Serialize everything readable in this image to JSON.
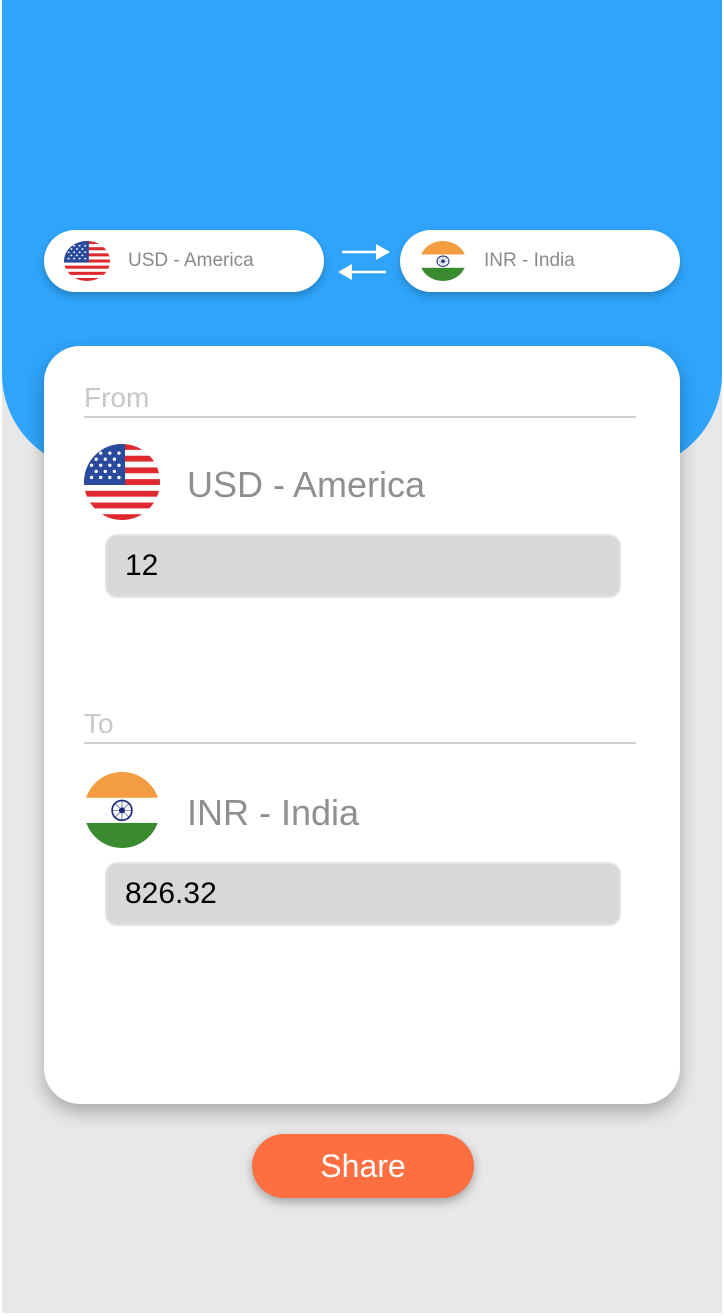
{
  "selector": {
    "from": {
      "label": "USD - America",
      "flag_icon": "us-flag-icon"
    },
    "to": {
      "label": "INR - India",
      "flag_icon": "india-flag-icon"
    },
    "swap_icon": "swap-arrows-icon"
  },
  "converter": {
    "from": {
      "section_label": "From",
      "currency": "USD - America",
      "amount": "12"
    },
    "to": {
      "section_label": "To",
      "currency": "INR - India",
      "amount": "826.32"
    }
  },
  "share_label": "Share",
  "colors": {
    "header": "#2fa4fa",
    "background": "#e8e8e8",
    "share_button": "#fd6f41",
    "india_saffron": "#f39c41",
    "india_green": "#3a8a2f",
    "us_red": "#e0292e",
    "us_blue": "#2a4a9e"
  }
}
